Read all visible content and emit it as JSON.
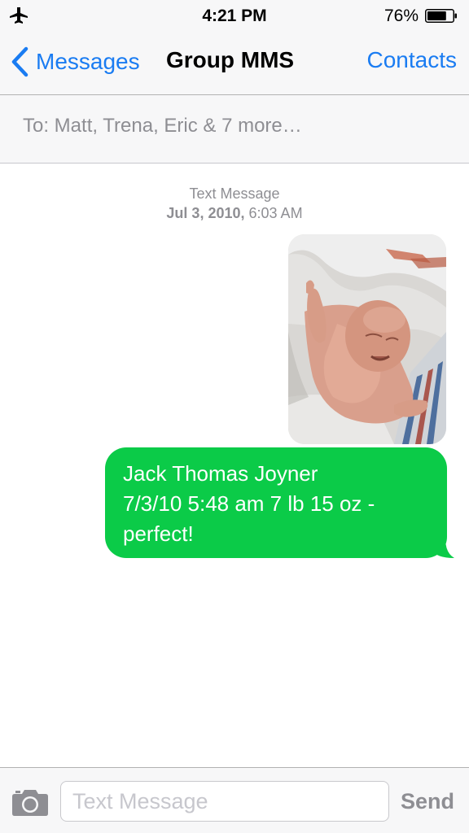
{
  "status_bar": {
    "airplane_icon": "airplane-icon",
    "time": "4:21 PM",
    "battery_percent": "76%",
    "battery_level": 0.76,
    "battery_icon": "battery-icon"
  },
  "nav": {
    "back_icon": "chevron-left-icon",
    "back_label": "Messages",
    "title": "Group MMS",
    "right_button": "Contacts"
  },
  "recipients": {
    "text": "To: Matt, Trena, Eric & 7 more…"
  },
  "conversation": {
    "header_label": "Text Message",
    "date": "Jul 3, 2010,",
    "time": "6:03 AM",
    "photo_message": {
      "description_icon": "photo-thumbnail"
    },
    "text_message": {
      "lines": [
        "Jack Thomas Joyner",
        "7/3/10 5:48 am 7 lb 15 oz -",
        "perfect!"
      ]
    }
  },
  "composer": {
    "camera_icon": "camera-icon",
    "input_value": "",
    "input_placeholder": "Text Message",
    "send_label": "Send"
  },
  "colors": {
    "accent_blue": "#1a7cf2",
    "bubble_green": "#0bcb48",
    "muted_gray": "#8e8e93",
    "bar_background": "#f7f7f8"
  }
}
